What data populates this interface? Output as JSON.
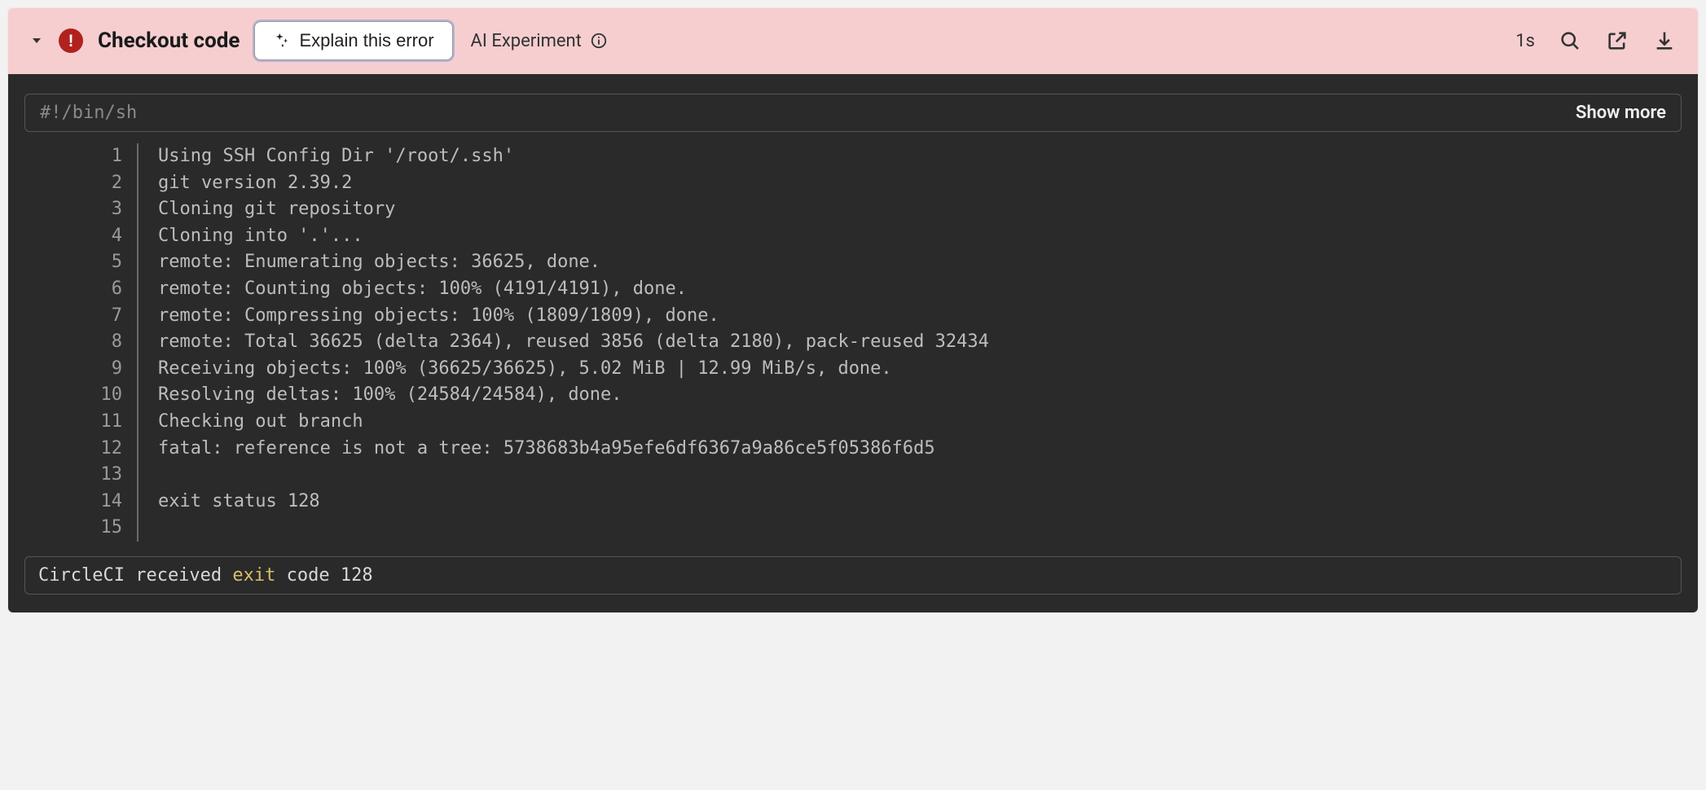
{
  "header": {
    "status": "error",
    "title": "Checkout code",
    "explain_label": "Explain this error",
    "ai_experiment_label": "AI Experiment",
    "duration": "1s"
  },
  "command": {
    "text": "#!/bin/sh",
    "show_more_label": "Show more"
  },
  "log_lines": [
    "Using SSH Config Dir '/root/.ssh'",
    "git version 2.39.2",
    "Cloning git repository",
    "Cloning into '.'...",
    "remote: Enumerating objects: 36625, done.",
    "remote: Counting objects: 100% (4191/4191), done.",
    "remote: Compressing objects: 100% (1809/1809), done.",
    "remote: Total 36625 (delta 2364), reused 3856 (delta 2180), pack-reused 32434",
    "Receiving objects: 100% (36625/36625), 5.02 MiB | 12.99 MiB/s, done.",
    "Resolving deltas: 100% (24584/24584), done.",
    "Checking out branch",
    "fatal: reference is not a tree: 5738683b4a95efe6df6367a9a86ce5f05386f6d5",
    "",
    "exit status 128",
    ""
  ],
  "footer": {
    "prefix": "CircleCI received ",
    "keyword": "exit",
    "suffix": " code 128"
  }
}
